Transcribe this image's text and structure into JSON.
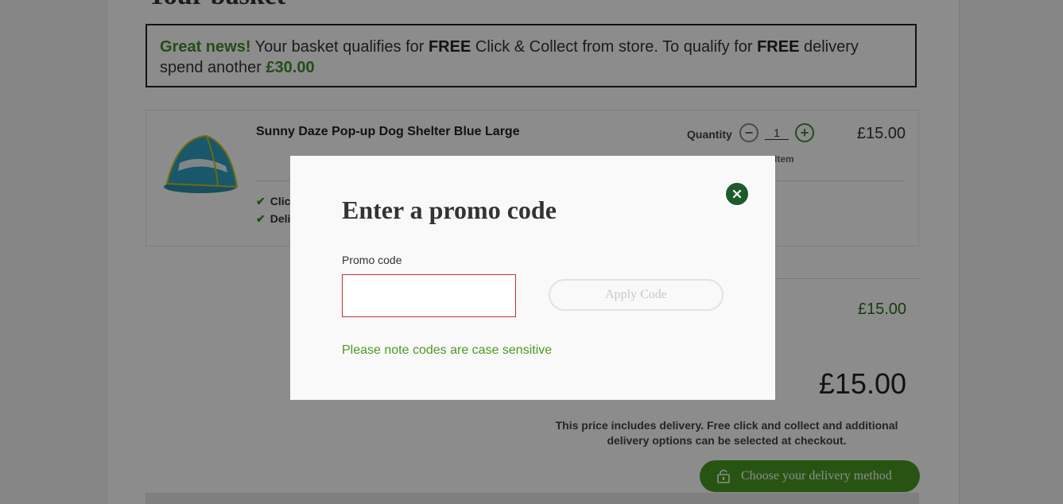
{
  "page": {
    "heading": "Your basket"
  },
  "banner": {
    "great_news": "Great news!",
    "text_1": " Your basket qualifies for ",
    "free_1": "FREE",
    "text_2": " Click & Collect from store. To qualify for ",
    "free_2": "FREE",
    "text_3": " delivery spend another ",
    "amount": "£30.00"
  },
  "item": {
    "title": "Sunny Daze Pop-up Dog Shelter Blue Large",
    "quantity_label": "Quantity",
    "quantity_value": "1",
    "price": "£15.00",
    "remove_label": "e Item",
    "option_1": "Clic",
    "option_2": "Deli"
  },
  "summary": {
    "subtotal": "£15.00",
    "total": "£15.00",
    "delivery_note": "This price includes delivery. Free click and collect and additional delivery options can be selected at checkout.",
    "delivery_button": "Choose your delivery method"
  },
  "modal": {
    "title": "Enter a promo code",
    "promo_label": "Promo code",
    "promo_value": "",
    "apply_button": "Apply Code",
    "case_note": "Please note codes are case sensitive"
  },
  "icons": {
    "close": "close-icon",
    "lock": "lock-icon",
    "check": "check-icon"
  },
  "colors": {
    "brand_green": "#4a9a23",
    "dark_green": "#1e5b2a",
    "error_border": "#c8302c"
  }
}
